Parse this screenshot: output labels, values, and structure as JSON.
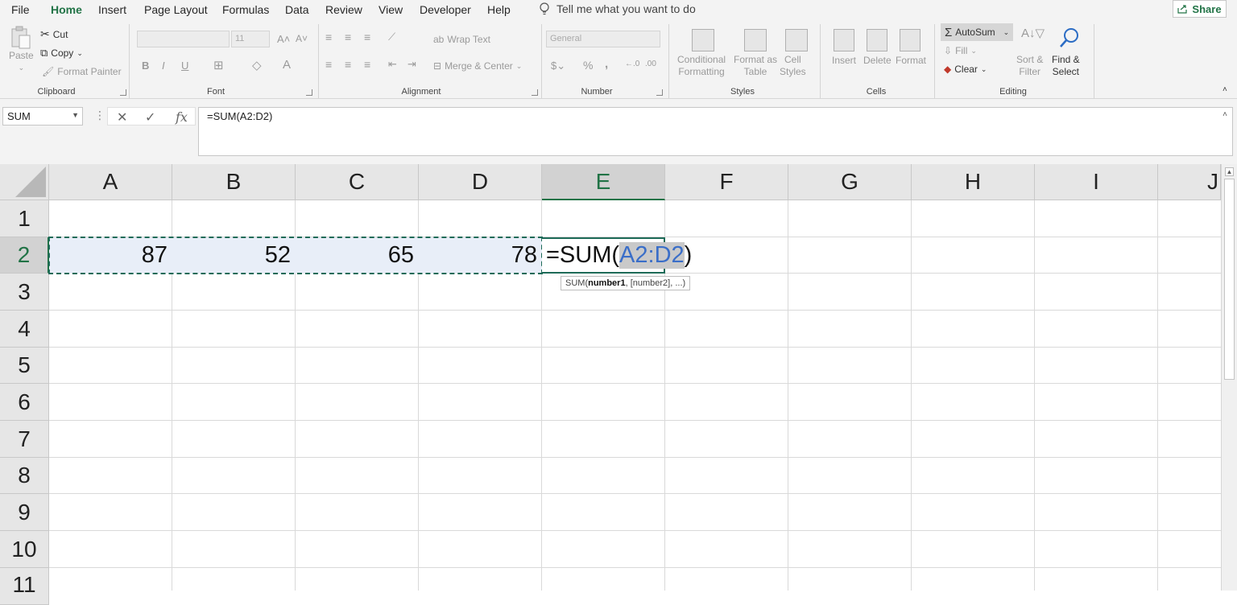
{
  "menu": {
    "tabs": [
      "File",
      "Home",
      "Insert",
      "Page Layout",
      "Formulas",
      "Data",
      "Review",
      "View",
      "Developer",
      "Help"
    ],
    "active_tab": "Home",
    "tell_me": "Tell me what you want to do",
    "share": "Share"
  },
  "ribbon": {
    "clipboard": {
      "label": "Clipboard",
      "paste": "Paste",
      "cut": "Cut",
      "copy": "Copy",
      "format_painter": "Format Painter"
    },
    "font": {
      "label": "Font",
      "size": "11",
      "bold": "B",
      "italic": "I",
      "underline": "U"
    },
    "alignment": {
      "label": "Alignment",
      "wrap_text": "Wrap Text",
      "merge_center": "Merge & Center"
    },
    "number": {
      "label": "Number",
      "format": "General",
      "percent": "%",
      "comma": ","
    },
    "styles": {
      "label": "Styles",
      "conditional": "Conditional",
      "conditional2": "Formatting",
      "format_as": "Format as",
      "format_as2": "Table",
      "cell": "Cell",
      "cell2": "Styles"
    },
    "cells": {
      "label": "Cells",
      "insert": "Insert",
      "delete": "Delete",
      "format": "Format"
    },
    "editing": {
      "label": "Editing",
      "autosum": "AutoSum",
      "fill": "Fill",
      "clear": "Clear",
      "sort": "Sort &",
      "sort2": "Filter",
      "find": "Find &",
      "find2": "Select"
    }
  },
  "formula_bar": {
    "name_box": "SUM",
    "cancel": "✕",
    "enter": "✓",
    "fx": "fx",
    "content": "=SUM(A2:D2)"
  },
  "grid": {
    "columns": [
      "A",
      "B",
      "C",
      "D",
      "E",
      "F",
      "G",
      "H",
      "I",
      "J"
    ],
    "rows": [
      "1",
      "2",
      "3",
      "4",
      "5",
      "6",
      "7",
      "8",
      "9",
      "10",
      "11"
    ],
    "selected_column": "E",
    "selected_row": "2",
    "row2_values": [
      "87",
      "52",
      "65",
      "78"
    ],
    "edit_prefix": "=SUM(",
    "edit_ref": "A2:D2",
    "edit_suffix": ")",
    "tooltip": {
      "fn": "SUM(",
      "arg1": "number1",
      "rest": ", [number2], ...)"
    }
  },
  "colors": {
    "accent": "#217346",
    "range_border": "#1e6b58",
    "ref_text": "#3a6ec8",
    "range_fill": "#e8eef8"
  }
}
